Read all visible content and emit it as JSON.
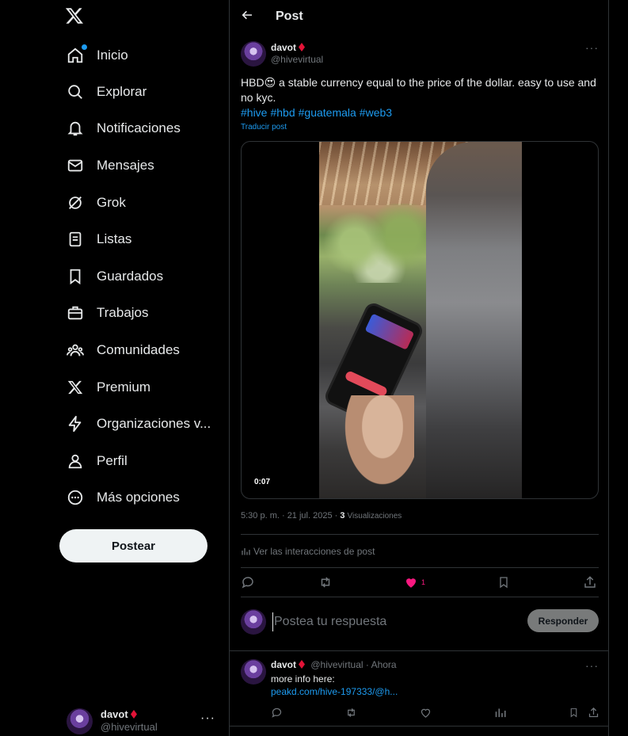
{
  "nav": {
    "items": [
      {
        "label": "Inicio",
        "icon": "home-icon",
        "badge": true
      },
      {
        "label": "Explorar",
        "icon": "search-icon"
      },
      {
        "label": "Notificaciones",
        "icon": "bell-icon"
      },
      {
        "label": "Mensajes",
        "icon": "envelope-icon"
      },
      {
        "label": "Grok",
        "icon": "grok-icon"
      },
      {
        "label": "Listas",
        "icon": "list-icon"
      },
      {
        "label": "Guardados",
        "icon": "bookmark-icon"
      },
      {
        "label": "Trabajos",
        "icon": "briefcase-icon"
      },
      {
        "label": "Comunidades",
        "icon": "communities-icon"
      },
      {
        "label": "Premium",
        "icon": "x-logo-icon"
      },
      {
        "label": "Organizaciones v...",
        "icon": "lightning-icon"
      },
      {
        "label": "Perfil",
        "icon": "person-icon"
      },
      {
        "label": "Más opciones",
        "icon": "more-circle-icon"
      }
    ],
    "post_button": "Postear"
  },
  "account": {
    "name": "davot",
    "handle": "@hivevirtual",
    "more": "···"
  },
  "header": {
    "title": "Post"
  },
  "tweet": {
    "name": "davot",
    "handle": "@hivevirtual",
    "text_prefix": "HBD",
    "emoji": "😍",
    "text_rest": " a stable currency equal to the price of the dollar. easy to use and no kyc.",
    "hashtags": [
      "#hive",
      "#hbd",
      "#guatemala",
      "#web3"
    ],
    "translate": "Traducir post",
    "video_time": "0:07",
    "time": "5:30 p. m. · 21 jul. 2025 ·",
    "views_count": "3",
    "views_label": "Visualizaciones",
    "interactions": "Ver las interacciones de post",
    "likes": "1",
    "more": "···"
  },
  "reply_box": {
    "placeholder": "Postea tu respuesta",
    "button": "Responder"
  },
  "reply": {
    "name": "davot",
    "handle": "@hivevirtual · Ahora",
    "text": "more info here:",
    "link": "peakd.com/hive-197333/@h...",
    "more": "···"
  },
  "colors": {
    "accent": "#1d9bf0",
    "like": "#f91880",
    "verified": "#e31337",
    "background": "#000000"
  }
}
